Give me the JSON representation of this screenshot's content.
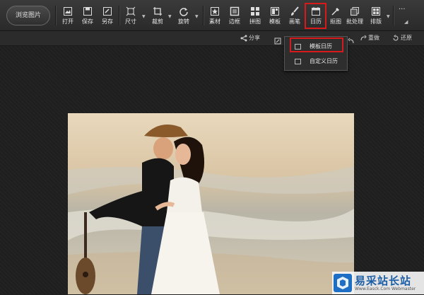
{
  "toolbar": {
    "browse_label": "浏览图片",
    "tools": [
      {
        "label": "打开",
        "icon": "open-image-icon"
      },
      {
        "label": "保存",
        "icon": "save-icon"
      },
      {
        "label": "另存",
        "icon": "save-as-icon"
      },
      {
        "label": "尺寸",
        "icon": "resize-icon"
      },
      {
        "label": "裁剪",
        "icon": "crop-icon"
      },
      {
        "label": "旋转",
        "icon": "rotate-icon"
      },
      {
        "label": "素材",
        "icon": "star-icon"
      },
      {
        "label": "边框",
        "icon": "frame-icon"
      },
      {
        "label": "拼图",
        "icon": "grid-icon"
      },
      {
        "label": "模板",
        "icon": "template-icon"
      },
      {
        "label": "画笔",
        "icon": "brush-icon"
      },
      {
        "label": "日历",
        "icon": "calendar-icon"
      },
      {
        "label": "抠图",
        "icon": "cutout-icon"
      },
      {
        "label": "批处理",
        "icon": "batch-icon"
      },
      {
        "label": "排版",
        "icon": "layout-icon"
      }
    ],
    "more": "···"
  },
  "actionbar": {
    "share": "分享",
    "redo": "重做",
    "restore": "还原"
  },
  "calendar_menu": {
    "items": [
      {
        "label": "模板日历",
        "icon": "template-calendar-icon"
      },
      {
        "label": "自定义日历",
        "icon": "custom-calendar-icon"
      }
    ]
  },
  "watermark": {
    "title": "易采站长站",
    "subtitle": "Www.Easck.Com Webmaster"
  },
  "colors": {
    "highlight": "#d91a1a",
    "toolbar_bg": "#333333",
    "canvas_bg": "#1f1f1f",
    "watermark_blue": "#1c5ea6"
  }
}
